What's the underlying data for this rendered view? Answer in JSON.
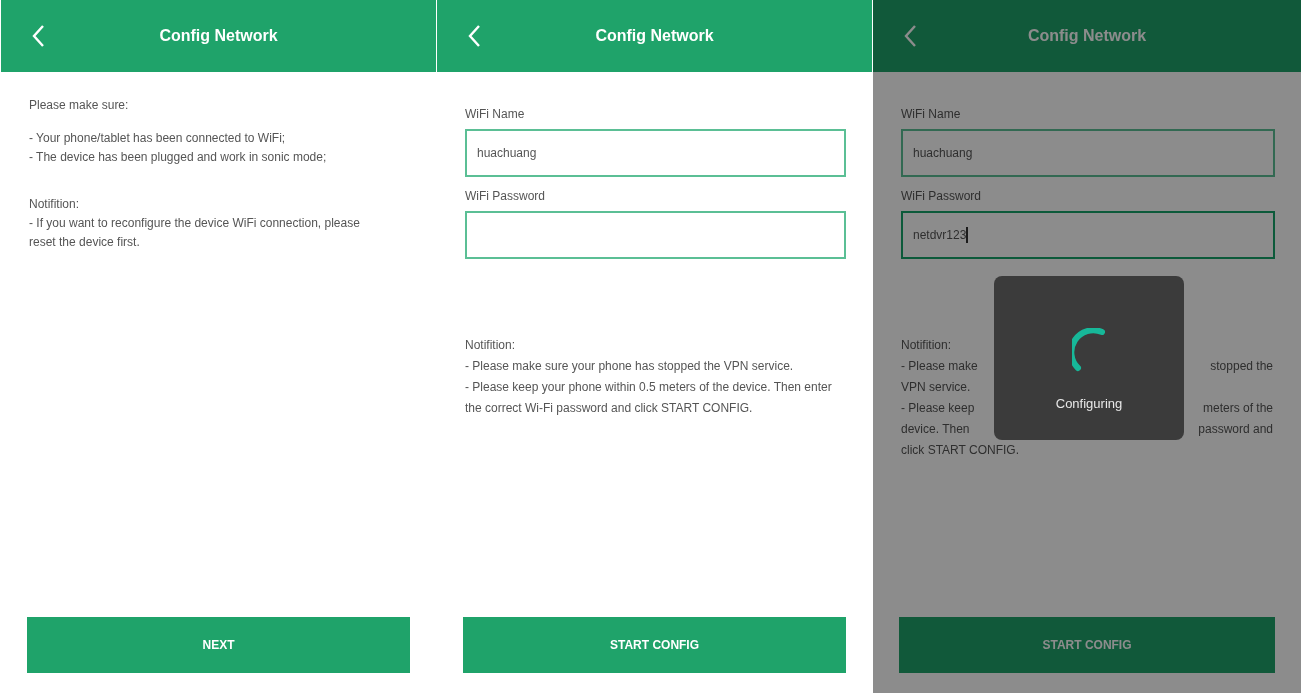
{
  "screens": [
    {
      "kind": "intro",
      "title": "Config Network",
      "intro": "Please make sure:",
      "items": [
        "- Your phone/tablet has been connected to WiFi;",
        "- The device has been plugged and work in sonic mode;"
      ],
      "note_heading": "Notifition:",
      "note_items": [
        "- If you want to reconfigure the device WiFi connection, please reset the device first."
      ],
      "button": "NEXT"
    },
    {
      "kind": "form",
      "title": "Config Network",
      "fields": [
        {
          "label": "WiFi Name",
          "value": "huachuang",
          "focused": false
        },
        {
          "label": "WiFi Password",
          "focused": false
        }
      ],
      "note_heading": "Notifition:",
      "note_items": [
        "- Please make sure your phone has stopped the VPN service.",
        "- Please keep your phone within 0.5 meters of the device. Then enter the correct Wi-Fi password and click START CONFIG."
      ],
      "button": "START CONFIG"
    },
    {
      "kind": "loading",
      "title": "Config Network",
      "fields": [
        {
          "label": "WiFi Name",
          "value": "huachuang",
          "focused": false
        },
        {
          "label": "WiFi Password",
          "value": "netdvr123",
          "focused": true
        }
      ],
      "note_heading": "Notifition:",
      "note_lines": [
        {
          "left": "- Please make",
          "right": "stopped the"
        },
        {
          "left": "VPN service."
        },
        {
          "left": "- Please keep",
          "right": "meters of the"
        },
        {
          "left": "device. Then",
          "right": "password and"
        },
        {
          "left": "click START CONFIG."
        }
      ],
      "loading_text": "Configuring",
      "button": "START CONFIG"
    }
  ]
}
